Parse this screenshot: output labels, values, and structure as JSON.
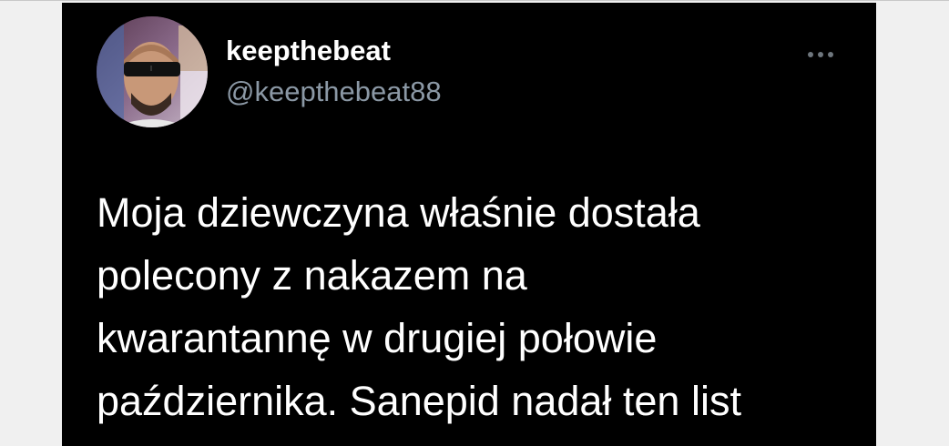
{
  "tweet": {
    "author": {
      "display_name": "keepthebeat",
      "handle": "@keepthebeat88",
      "avatar_icon": "profile-photo"
    },
    "more_icon": "ellipsis-icon",
    "text_lines": [
      "Moja dziewczyna właśnie dostała",
      "polecony z nakazem na",
      "kwarantannę w drugiej połowie",
      "października. Sanepid nadał ten list"
    ]
  },
  "colors": {
    "card_background": "#000000",
    "text_primary": "#ffffff",
    "text_secondary": "#8b98a5",
    "page_background": "#f0f0f0"
  }
}
